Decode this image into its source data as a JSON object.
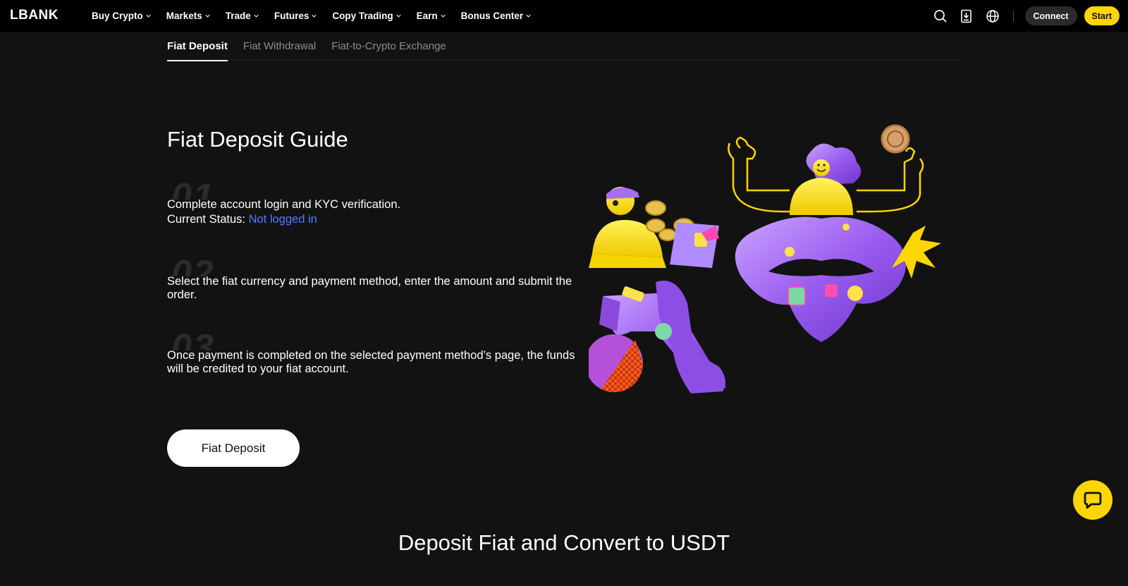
{
  "brand": {
    "logo_text": "LBANK",
    "accent": "#ffd600",
    "link_color": "#4f7cff",
    "background": "#121212"
  },
  "nav": {
    "items": [
      {
        "label": "Buy Crypto"
      },
      {
        "label": "Markets"
      },
      {
        "label": "Trade"
      },
      {
        "label": "Futures"
      },
      {
        "label": "Copy Trading"
      },
      {
        "label": "Earn"
      },
      {
        "label": "Bonus Center"
      }
    ],
    "icons": [
      "search-icon",
      "download-app-icon",
      "language-globe-icon"
    ],
    "connect_label": "Connect",
    "start_label": "Start"
  },
  "tabs": [
    {
      "label": "Fiat Deposit",
      "active": true
    },
    {
      "label": "Fiat Withdrawal",
      "active": false
    },
    {
      "label": "Fiat-to-Crypto Exchange",
      "active": false
    }
  ],
  "guide": {
    "title": "Fiat Deposit Guide",
    "steps": [
      {
        "number": "01",
        "text": "Complete account login and KYC verification.",
        "status_label": "Current Status:",
        "status_value": "Not logged in"
      },
      {
        "number": "02",
        "text": "Select the fiat currency and payment method, enter the amount and submit the order."
      },
      {
        "number": "03",
        "text": "Once payment is completed on the selected payment method’s page, the funds will be credited to your fiat account."
      }
    ],
    "button_label": "Fiat Deposit"
  },
  "chat": {
    "icon": "chat-bubble-icon"
  },
  "section": {
    "title": "Deposit Fiat and Convert to USDT"
  }
}
